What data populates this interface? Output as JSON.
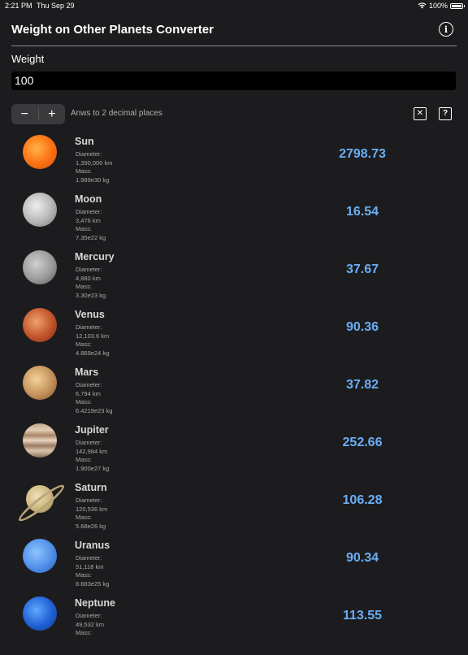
{
  "status": {
    "time": "2:21 PM",
    "date": "Thu Sep 29",
    "battery": "100%"
  },
  "header": {
    "title": "Weight on Other Planets Converter"
  },
  "weight": {
    "label": "Weight",
    "value": "100"
  },
  "controls": {
    "minus": "−",
    "plus": "+",
    "decimals_text": "Anws to 2 decimal places",
    "clear_icon": "✕",
    "help_icon": "?"
  },
  "planets": [
    {
      "name": "Sun",
      "diameter_label": "Diameter:",
      "diameter": "1,390,000 km",
      "mass_label": "Mass:",
      "mass": "1.989e30 kg",
      "value": "2798.73"
    },
    {
      "name": "Moon",
      "diameter_label": "Diameter:",
      "diameter": "3,476 km",
      "mass_label": "Mass:",
      "mass": "7.35e22 kg",
      "value": "16.54"
    },
    {
      "name": "Mercury",
      "diameter_label": "Diameter:",
      "diameter": "4,880 km",
      "mass_label": "Mass:",
      "mass": "3.30e23 kg",
      "value": "37.67"
    },
    {
      "name": "Venus",
      "diameter_label": "Diameter:",
      "diameter": "12,103.6 km",
      "mass_label": "Mass:",
      "mass": "4.869e24 kg",
      "value": "90.36"
    },
    {
      "name": "Mars",
      "diameter_label": "Diameter:",
      "diameter": "6,794 km",
      "mass_label": "Mass:",
      "mass": "6.4219e23 kg",
      "value": "37.82"
    },
    {
      "name": "Jupiter",
      "diameter_label": "Diameter:",
      "diameter": "142,984 km",
      "mass_label": "Mass:",
      "mass": "1.900e27 kg",
      "value": "252.66"
    },
    {
      "name": "Saturn",
      "diameter_label": "Diameter:",
      "diameter": "120,536 km",
      "mass_label": "Mass:",
      "mass": "5.68e26 kg",
      "value": "106.28"
    },
    {
      "name": "Uranus",
      "diameter_label": "Diameter:",
      "diameter": "51,118 km",
      "mass_label": "Mass:",
      "mass": "8.683e25 kg",
      "value": "90.34"
    },
    {
      "name": "Neptune",
      "diameter_label": "Diameter:",
      "diameter": "49,532 km",
      "mass_label": "Mass:",
      "mass": "",
      "value": "113.55"
    }
  ]
}
